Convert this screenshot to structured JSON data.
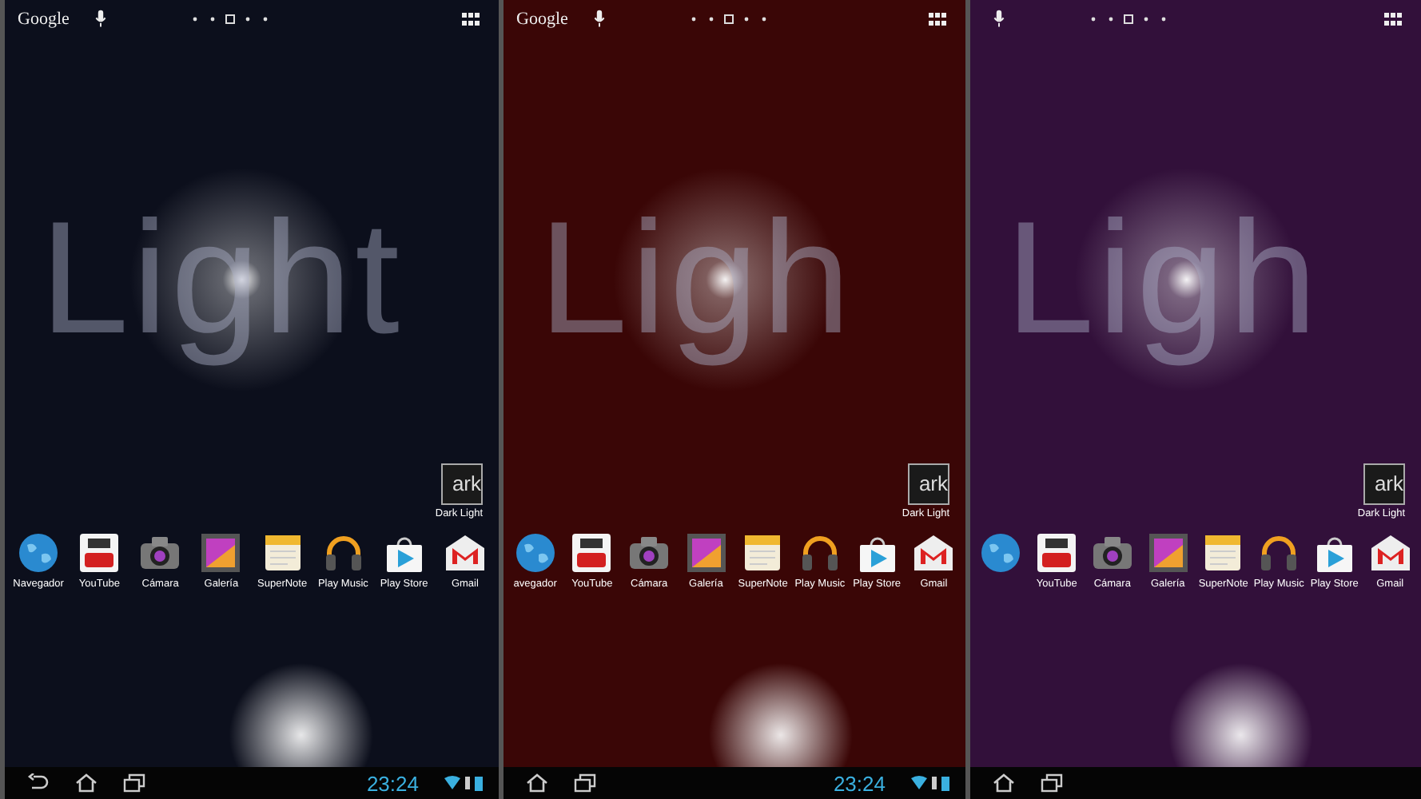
{
  "screens": [
    {
      "color": "#0c0f1c",
      "search_label": "Google",
      "wallpaper_text": "Light",
      "widget": {
        "icon_text": "ark",
        "label": "Dark Light"
      },
      "apps": [
        {
          "kind": "browser",
          "label": "Navegador"
        },
        {
          "kind": "video",
          "label": "YouTube"
        },
        {
          "kind": "camera",
          "label": "Cámara"
        },
        {
          "kind": "gallery",
          "label": "Galería"
        },
        {
          "kind": "notes",
          "label": "SuperNote"
        },
        {
          "kind": "music",
          "label": "Play Music"
        },
        {
          "kind": "store",
          "label": "Play Store"
        },
        {
          "kind": "mail",
          "label": "Gmail"
        }
      ],
      "nav": [
        {
          "kind": "back"
        },
        {
          "kind": "home"
        },
        {
          "kind": "recents"
        }
      ],
      "clock": "23:24"
    },
    {
      "color": "#3a0606",
      "search_label": "Google",
      "wallpaper_text": "Ligh",
      "widget": {
        "icon_text": "ark",
        "label": "Dark Light"
      },
      "apps": [
        {
          "kind": "browser",
          "label": "avegador"
        },
        {
          "kind": "video",
          "label": "YouTube"
        },
        {
          "kind": "camera",
          "label": "Cámara"
        },
        {
          "kind": "gallery",
          "label": "Galería"
        },
        {
          "kind": "notes",
          "label": "SuperNote"
        },
        {
          "kind": "music",
          "label": "Play Music"
        },
        {
          "kind": "store",
          "label": "Play Store"
        },
        {
          "kind": "mail",
          "label": "Gmail"
        }
      ],
      "nav": [
        {
          "kind": "home"
        },
        {
          "kind": "recents"
        }
      ],
      "clock": "23:24"
    },
    {
      "color": "#32103a",
      "wallpaper_text": "Ligh",
      "widget": {
        "icon_text": "ark",
        "label": "Dark Light"
      },
      "apps": [
        {
          "kind": "browser"
        },
        {
          "kind": "video",
          "label": "YouTube"
        },
        {
          "kind": "camera",
          "label": "Cámara"
        },
        {
          "kind": "gallery",
          "label": "Galería"
        },
        {
          "kind": "notes",
          "label": "SuperNote"
        },
        {
          "kind": "music",
          "label": "Play Music"
        },
        {
          "kind": "store",
          "label": "Play Store"
        },
        {
          "kind": "mail",
          "label": "Gmail"
        }
      ],
      "nav": [
        {
          "kind": "home"
        },
        {
          "kind": "recents"
        }
      ]
    }
  ]
}
